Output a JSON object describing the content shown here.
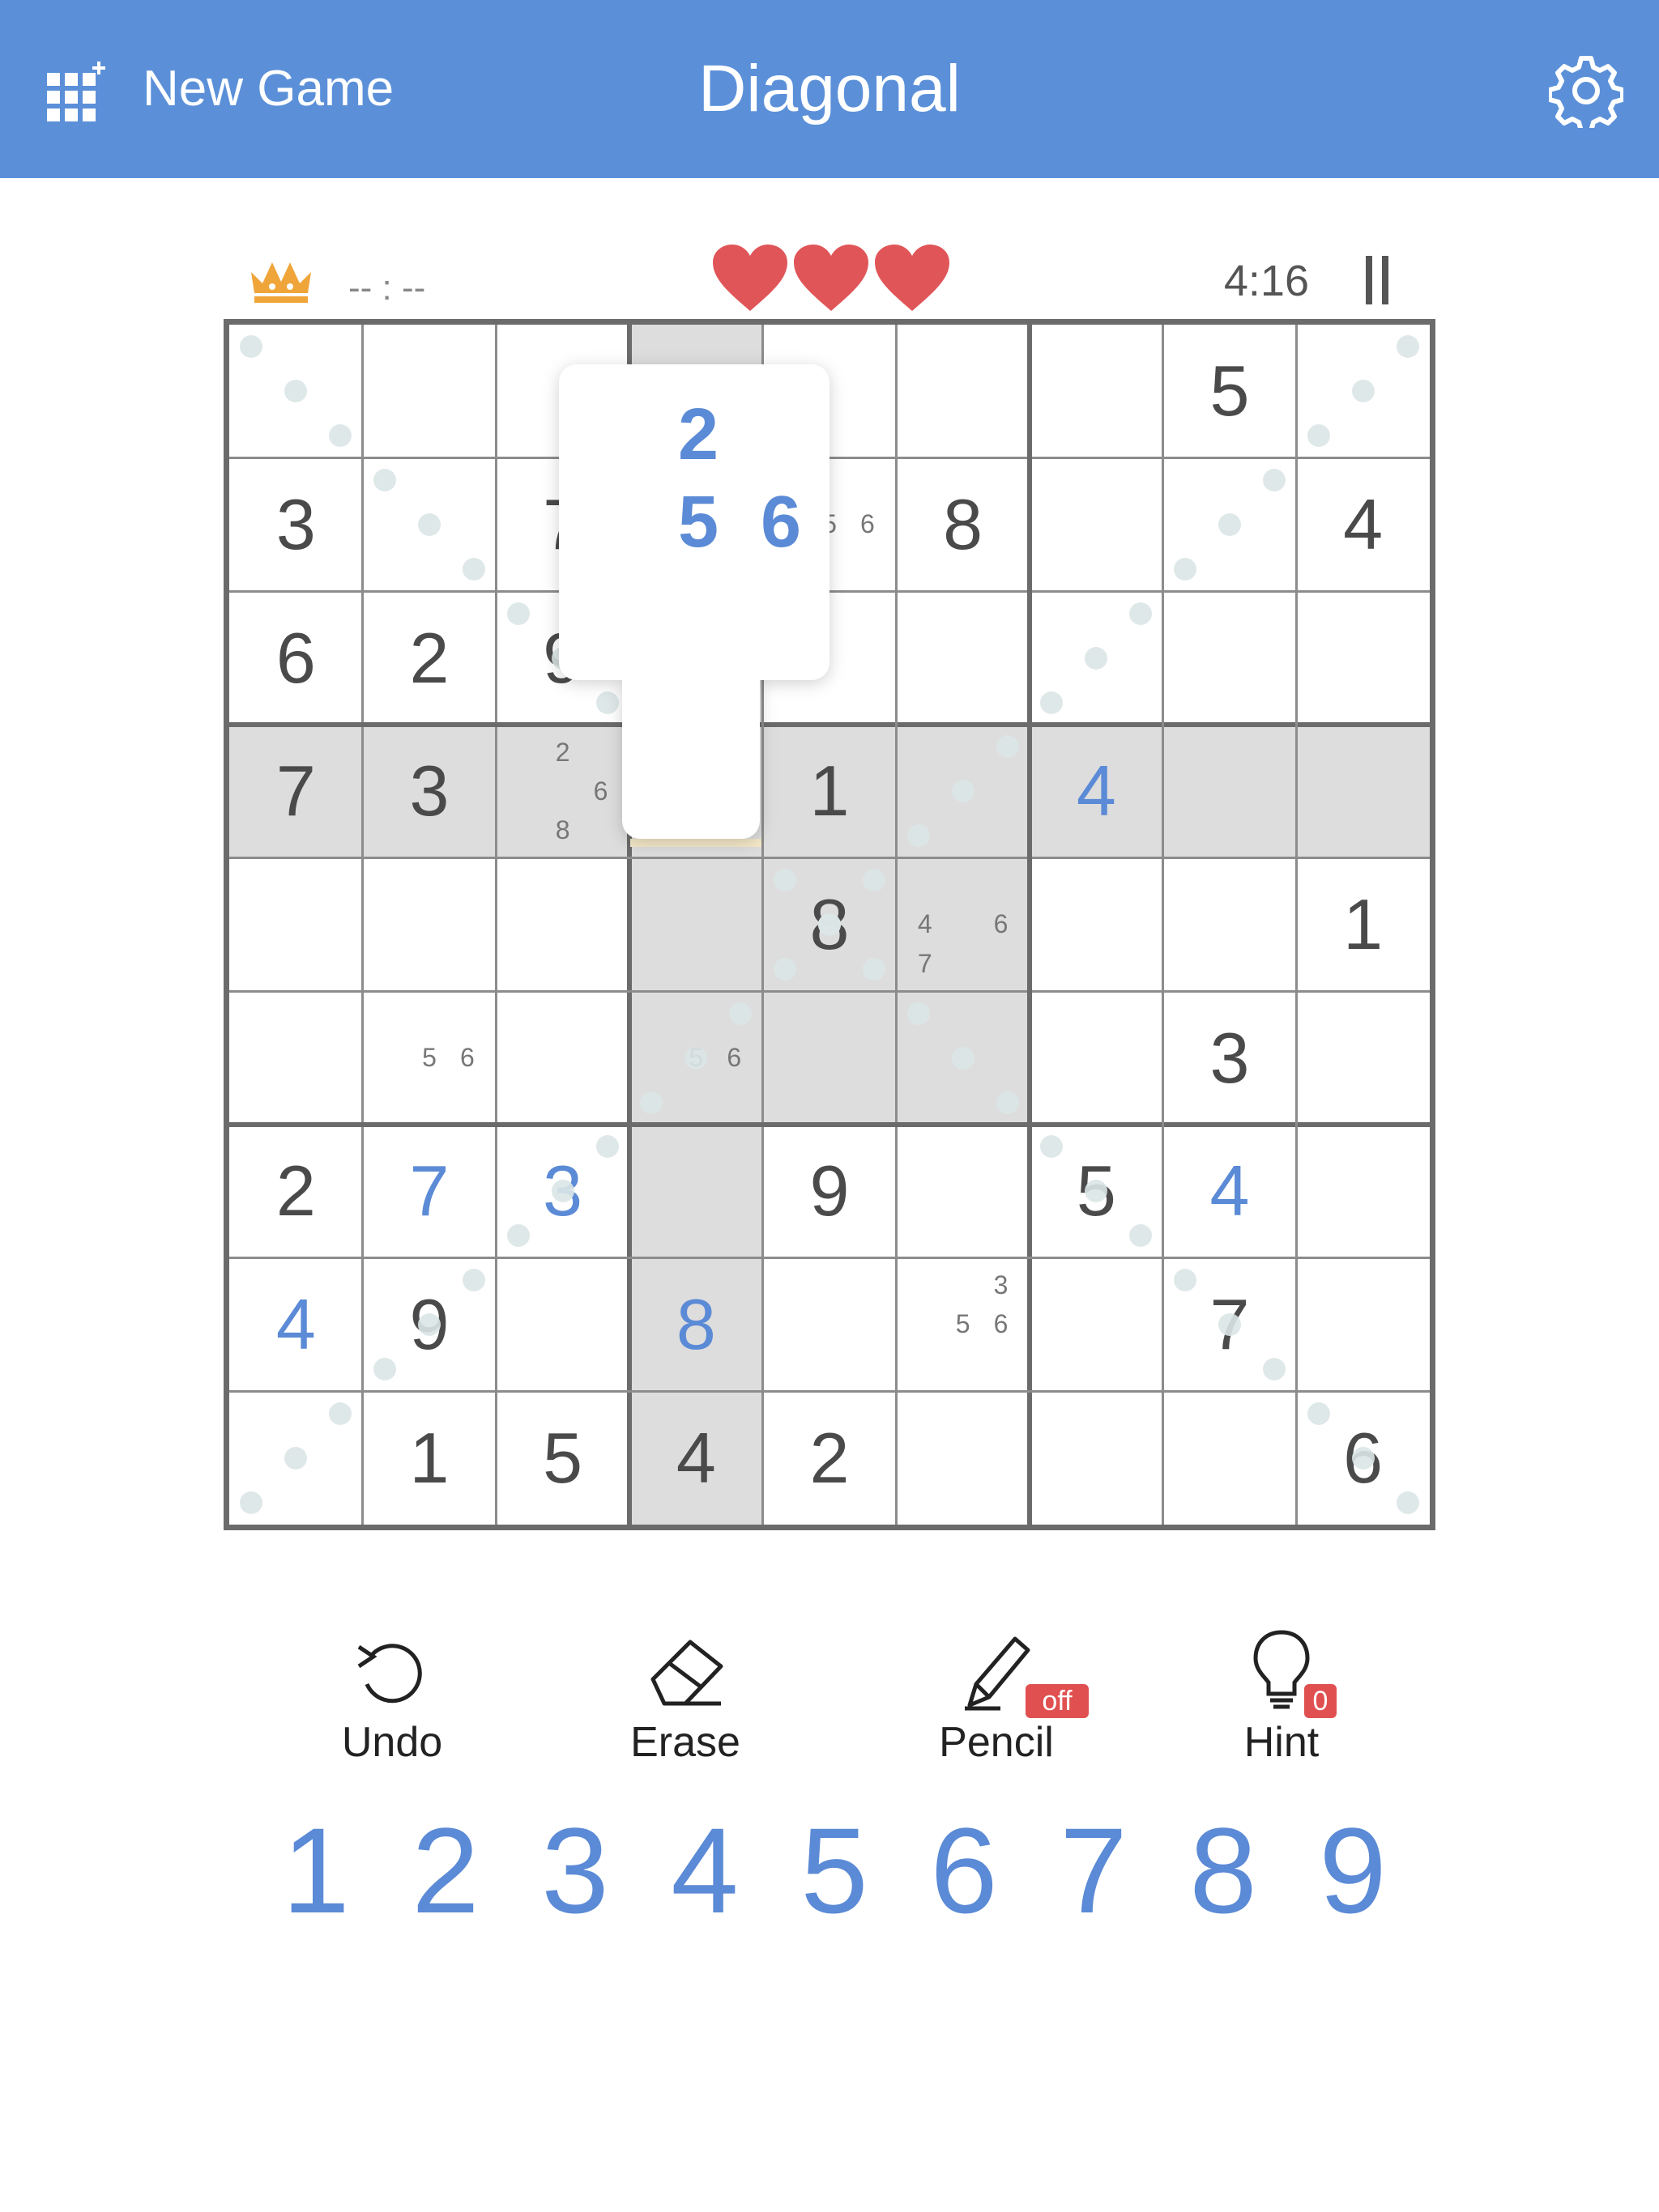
{
  "header": {
    "new_game_label": "New Game",
    "title": "Diagonal",
    "icons": {
      "new_game": "grid-plus-icon",
      "settings": "gear-icon"
    }
  },
  "status": {
    "best_time": "-- : --",
    "timer": "4:16",
    "lives": 3,
    "colors": {
      "accent": "#5b90d9",
      "heart": "#e05558",
      "crown": "#f0a53a",
      "user_digit": "#5b8ad6"
    }
  },
  "board": {
    "cells": [
      [
        null,
        null,
        null,
        null,
        null,
        null,
        null,
        "5",
        null
      ],
      [
        "3",
        null,
        "7",
        null,
        null,
        "8",
        null,
        null,
        "4"
      ],
      [
        "6",
        "2",
        "9",
        null,
        null,
        null,
        null,
        null,
        null
      ],
      [
        "7",
        "3",
        null,
        null,
        "1",
        null,
        "4",
        null,
        null
      ],
      [
        null,
        null,
        null,
        null,
        "8",
        null,
        null,
        null,
        "1"
      ],
      [
        null,
        null,
        null,
        null,
        null,
        null,
        null,
        "3",
        null
      ],
      [
        "2",
        "7",
        "3",
        null,
        "9",
        null,
        "5",
        "4",
        null
      ],
      [
        "4",
        "9",
        null,
        "8",
        null,
        null,
        null,
        "7",
        null
      ],
      [
        null,
        "1",
        "5",
        "4",
        "2",
        null,
        null,
        null,
        "6"
      ]
    ],
    "user_cells": [
      [
        3,
        6
      ],
      [
        6,
        1
      ],
      [
        6,
        2
      ],
      [
        6,
        7
      ],
      [
        7,
        0
      ],
      [
        7,
        3
      ]
    ],
    "notes": [
      {
        "r": 1,
        "c": 4,
        "values": [
          "5",
          "6"
        ]
      },
      {
        "r": 3,
        "c": 2,
        "values": [
          "2",
          "6",
          "8"
        ]
      },
      {
        "r": 4,
        "c": 5,
        "values": [
          "4",
          "6",
          "7"
        ]
      },
      {
        "r": 5,
        "c": 1,
        "values": [
          "5",
          "6"
        ]
      },
      {
        "r": 5,
        "c": 3,
        "values": [
          "5",
          "6"
        ]
      },
      {
        "r": 7,
        "c": 5,
        "values": [
          "3",
          "5",
          "6"
        ]
      }
    ],
    "selected": {
      "r": 0,
      "c": 3
    },
    "candidate_popup": [
      "2",
      "5",
      "6"
    ]
  },
  "tools": [
    {
      "id": "undo",
      "label": "Undo",
      "icon": "undo-icon"
    },
    {
      "id": "erase",
      "label": "Erase",
      "icon": "eraser-icon"
    },
    {
      "id": "pencil",
      "label": "Pencil",
      "icon": "pencil-icon",
      "badge": "off"
    },
    {
      "id": "hint",
      "label": "Hint",
      "icon": "lightbulb-icon",
      "badge": "0"
    }
  ],
  "numpad": [
    "1",
    "2",
    "3",
    "4",
    "5",
    "6",
    "7",
    "8",
    "9"
  ]
}
